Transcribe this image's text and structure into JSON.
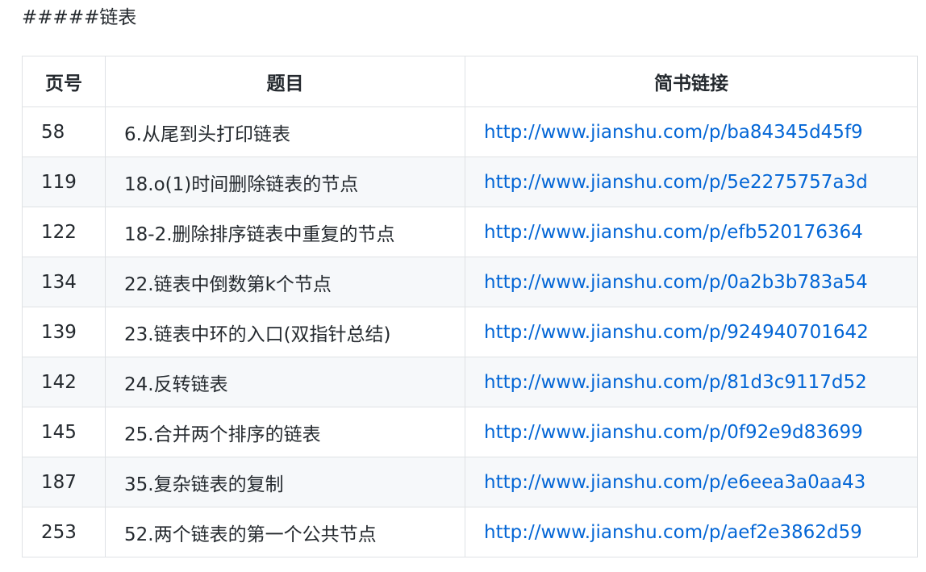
{
  "heading": "#####链表",
  "table": {
    "headers": [
      "页号",
      "题目",
      "简书链接"
    ],
    "rows": [
      {
        "page": "58",
        "title": "6.从尾到头打印链表",
        "url": "http://www.jianshu.com/p/ba84345d45f9"
      },
      {
        "page": "119",
        "title": "18.o(1)时间删除链表的节点",
        "url": "http://www.jianshu.com/p/5e2275757a3d"
      },
      {
        "page": "122",
        "title": "18-2.删除排序链表中重复的节点",
        "url": "http://www.jianshu.com/p/efb520176364"
      },
      {
        "page": "134",
        "title": "22.链表中倒数第k个节点",
        "url": "http://www.jianshu.com/p/0a2b3b783a54"
      },
      {
        "page": "139",
        "title": "23.链表中环的入口(双指针总结)",
        "url": "http://www.jianshu.com/p/924940701642"
      },
      {
        "page": "142",
        "title": "24.反转链表",
        "url": "http://www.jianshu.com/p/81d3c9117d52"
      },
      {
        "page": "145",
        "title": "25.合并两个排序的链表",
        "url": "http://www.jianshu.com/p/0f92e9d83699"
      },
      {
        "page": "187",
        "title": "35.复杂链表的复制",
        "url": "http://www.jianshu.com/p/e6eea3a0aa43"
      },
      {
        "page": "253",
        "title": "52.两个链表的第一个公共节点",
        "url": "http://www.jianshu.com/p/aef2e3862d59"
      }
    ]
  },
  "colors": {
    "text": "#24292e",
    "link": "#0366d6",
    "border": "#dfe2e5",
    "stripe": "#f6f8fa"
  }
}
